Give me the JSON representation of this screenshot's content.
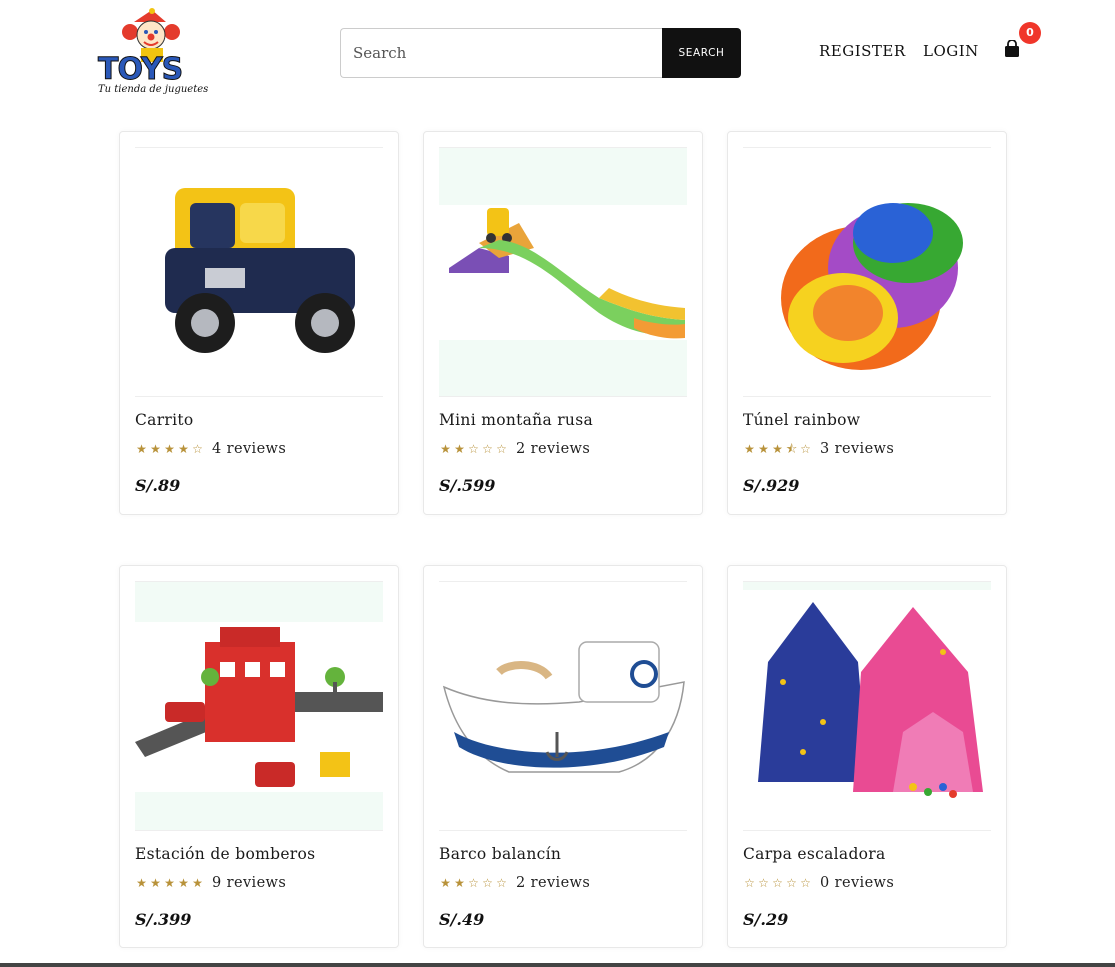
{
  "header": {
    "logo_text": "TOYS",
    "logo_tagline": "Tu tienda de juguetes",
    "search_placeholder": "Search",
    "search_button": "SEARCH",
    "register_label": "REGISTER",
    "login_label": "LOGIN",
    "cart_count": "0",
    "cart_icon": "shopping-bag-icon"
  },
  "colors": {
    "star": "#b8923a",
    "badge": "#f0362a",
    "button": "#111111"
  },
  "products": [
    {
      "name": "Carrito",
      "rating": 4,
      "rating_max": 5,
      "reviews": "4 reviews",
      "price": "S/.89"
    },
    {
      "name": "Mini montaña rusa",
      "rating": 2,
      "rating_max": 5,
      "reviews": "2 reviews",
      "price": "S/.599"
    },
    {
      "name": "Túnel rainbow",
      "rating": 3.5,
      "rating_max": 5,
      "reviews": "3 reviews",
      "price": "S/.929"
    },
    {
      "name": "Estación de bomberos",
      "rating": 5,
      "rating_max": 5,
      "reviews": "9 reviews",
      "price": "S/.399"
    },
    {
      "name": "Barco balancín",
      "rating": 2,
      "rating_max": 5,
      "reviews": "2 reviews",
      "price": "S/.49"
    },
    {
      "name": "Carpa escaladora",
      "rating": 0,
      "rating_max": 5,
      "reviews": "0 reviews",
      "price": "S/.29"
    }
  ]
}
